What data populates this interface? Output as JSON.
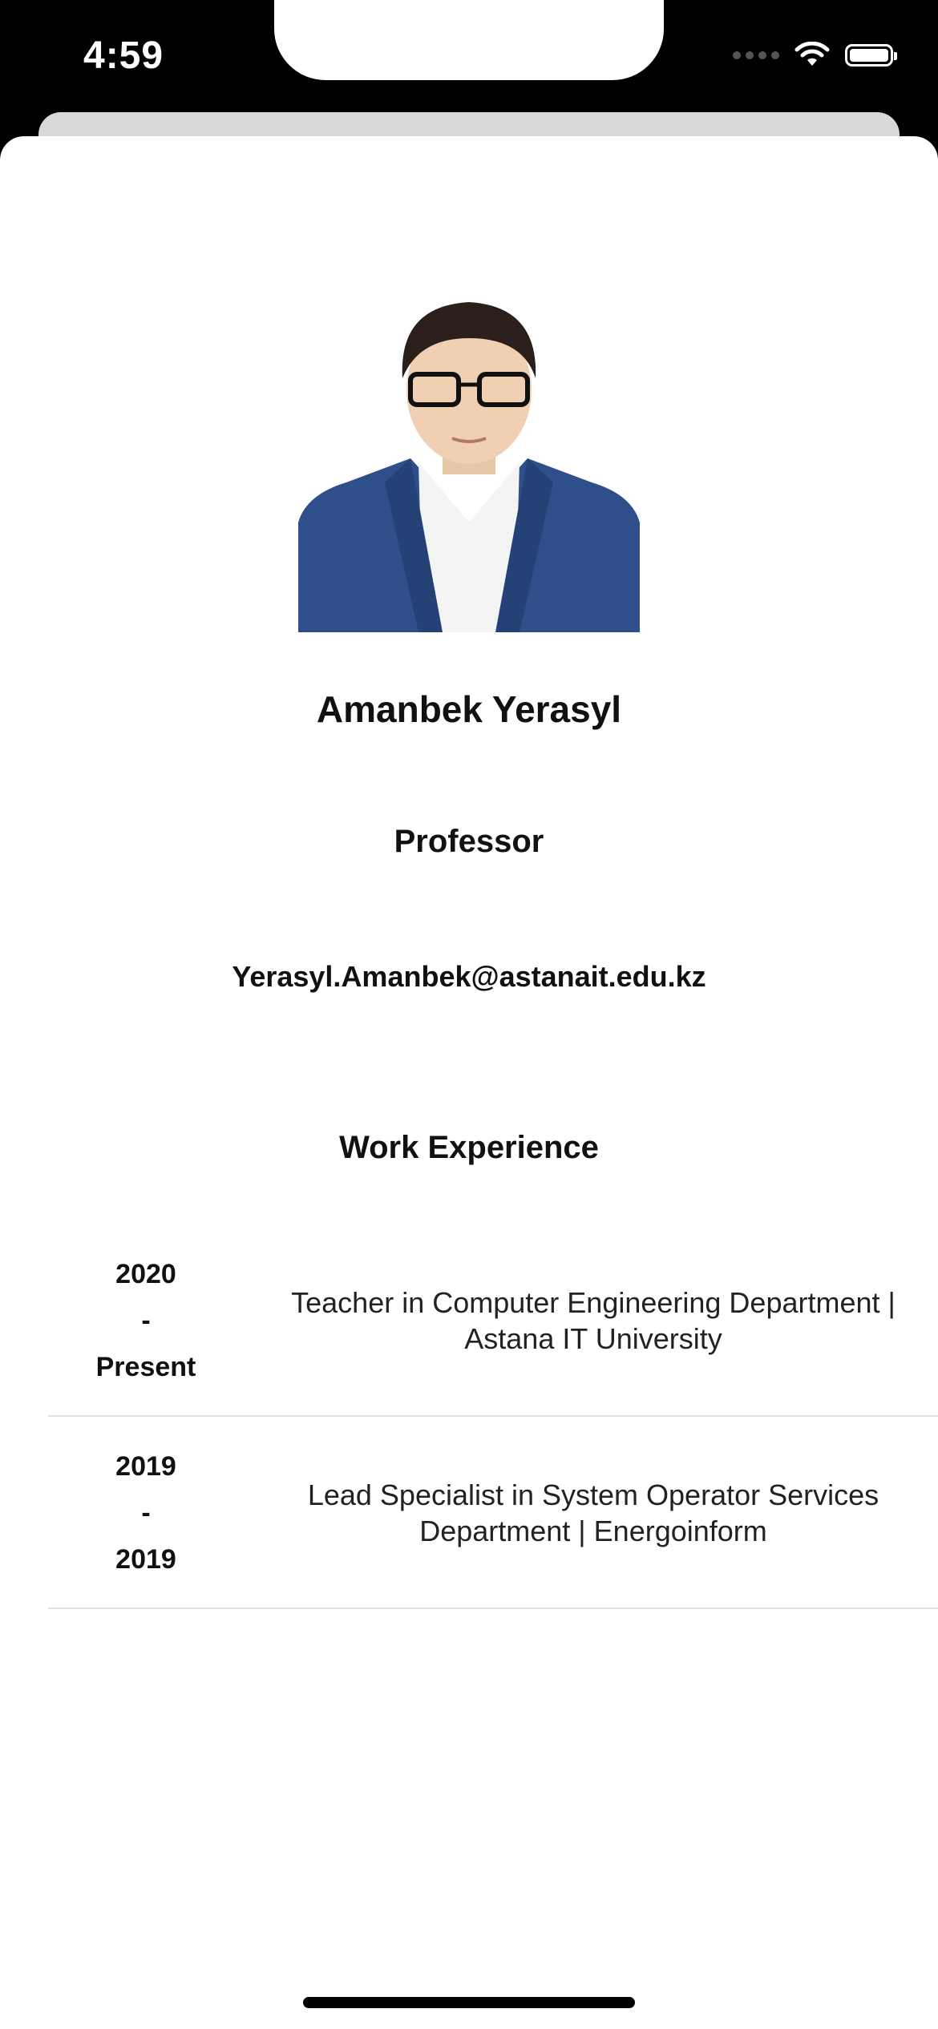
{
  "status_bar": {
    "time": "4:59"
  },
  "profile": {
    "name": "Amanbek Yerasyl",
    "role": "Professor",
    "email": "Yerasyl.Amanbek@astanait.edu.kz"
  },
  "work_experience": {
    "title": "Work Experience",
    "items": [
      {
        "start": "2020",
        "separator": "-",
        "end": "Present",
        "description": "Teacher in Computer Engineering Department | Astana IT University"
      },
      {
        "start": "2019",
        "separator": "-",
        "end": "2019",
        "description": "Lead Specialist in System Operator Services Department | Energoinform"
      }
    ]
  },
  "colors": {
    "background": "#ffffff",
    "text": "#111111",
    "divider": "#e2e2e2",
    "status_bar": "#000000"
  }
}
